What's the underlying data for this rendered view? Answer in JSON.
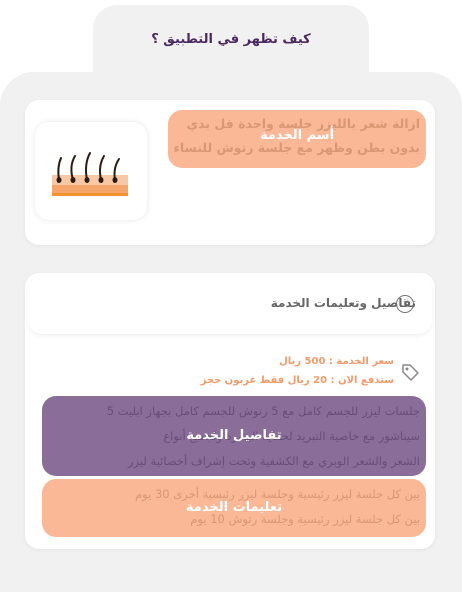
{
  "header": {
    "title": "كيف تظهر في التطبيق ؟"
  },
  "service": {
    "title_line1": "ازالة شعر بالليزر جلسة واحدة فل بدي",
    "title_line2": "بدون بطن وظهر مع جلسة رتوش للنساء",
    "overlay_label": "أسم الخدمة",
    "image_icon": "hair-follicle-skin-illustration"
  },
  "details_section": {
    "header": "تفاصيل وتعليمات الخدمة",
    "header_icon": "info-icon",
    "price_line": "سعر الخدمة : 500 ريال",
    "deposit_line": "ستدفع الان : 20 ريال فقط عربون حجز",
    "price_icon": "tag-icon",
    "details": {
      "line1": "جلسات ليزر للجسم كامل مع 5 رتوش للجسم كامل بجهاز ابليت 5",
      "line2": "سيناشور مع خاصية التبريد لحماية البشرة ولجميع أنواع",
      "line3": "الشعر والشعر الوبري مع الكشفية وتحت إشراف أخصائية ليزر",
      "overlay_label": "تفاصيل الخدمة"
    },
    "instructions": {
      "line1": "بين كل جلسة ليزر رئيسية وجلسة ليزر رئيسية أخرى 30 يوم",
      "line2": "بين كل جلسة ليزر رئيسية وجلسة رتوش 10 يوم",
      "overlay_label": "تعليمات الخدمة"
    }
  },
  "colors": {
    "title": "#4a2a5e",
    "peach_overlay": "#fbb896",
    "purple_overlay": "#8a6e99",
    "price_text": "#f39a6a",
    "background": "#f1f1f1"
  }
}
